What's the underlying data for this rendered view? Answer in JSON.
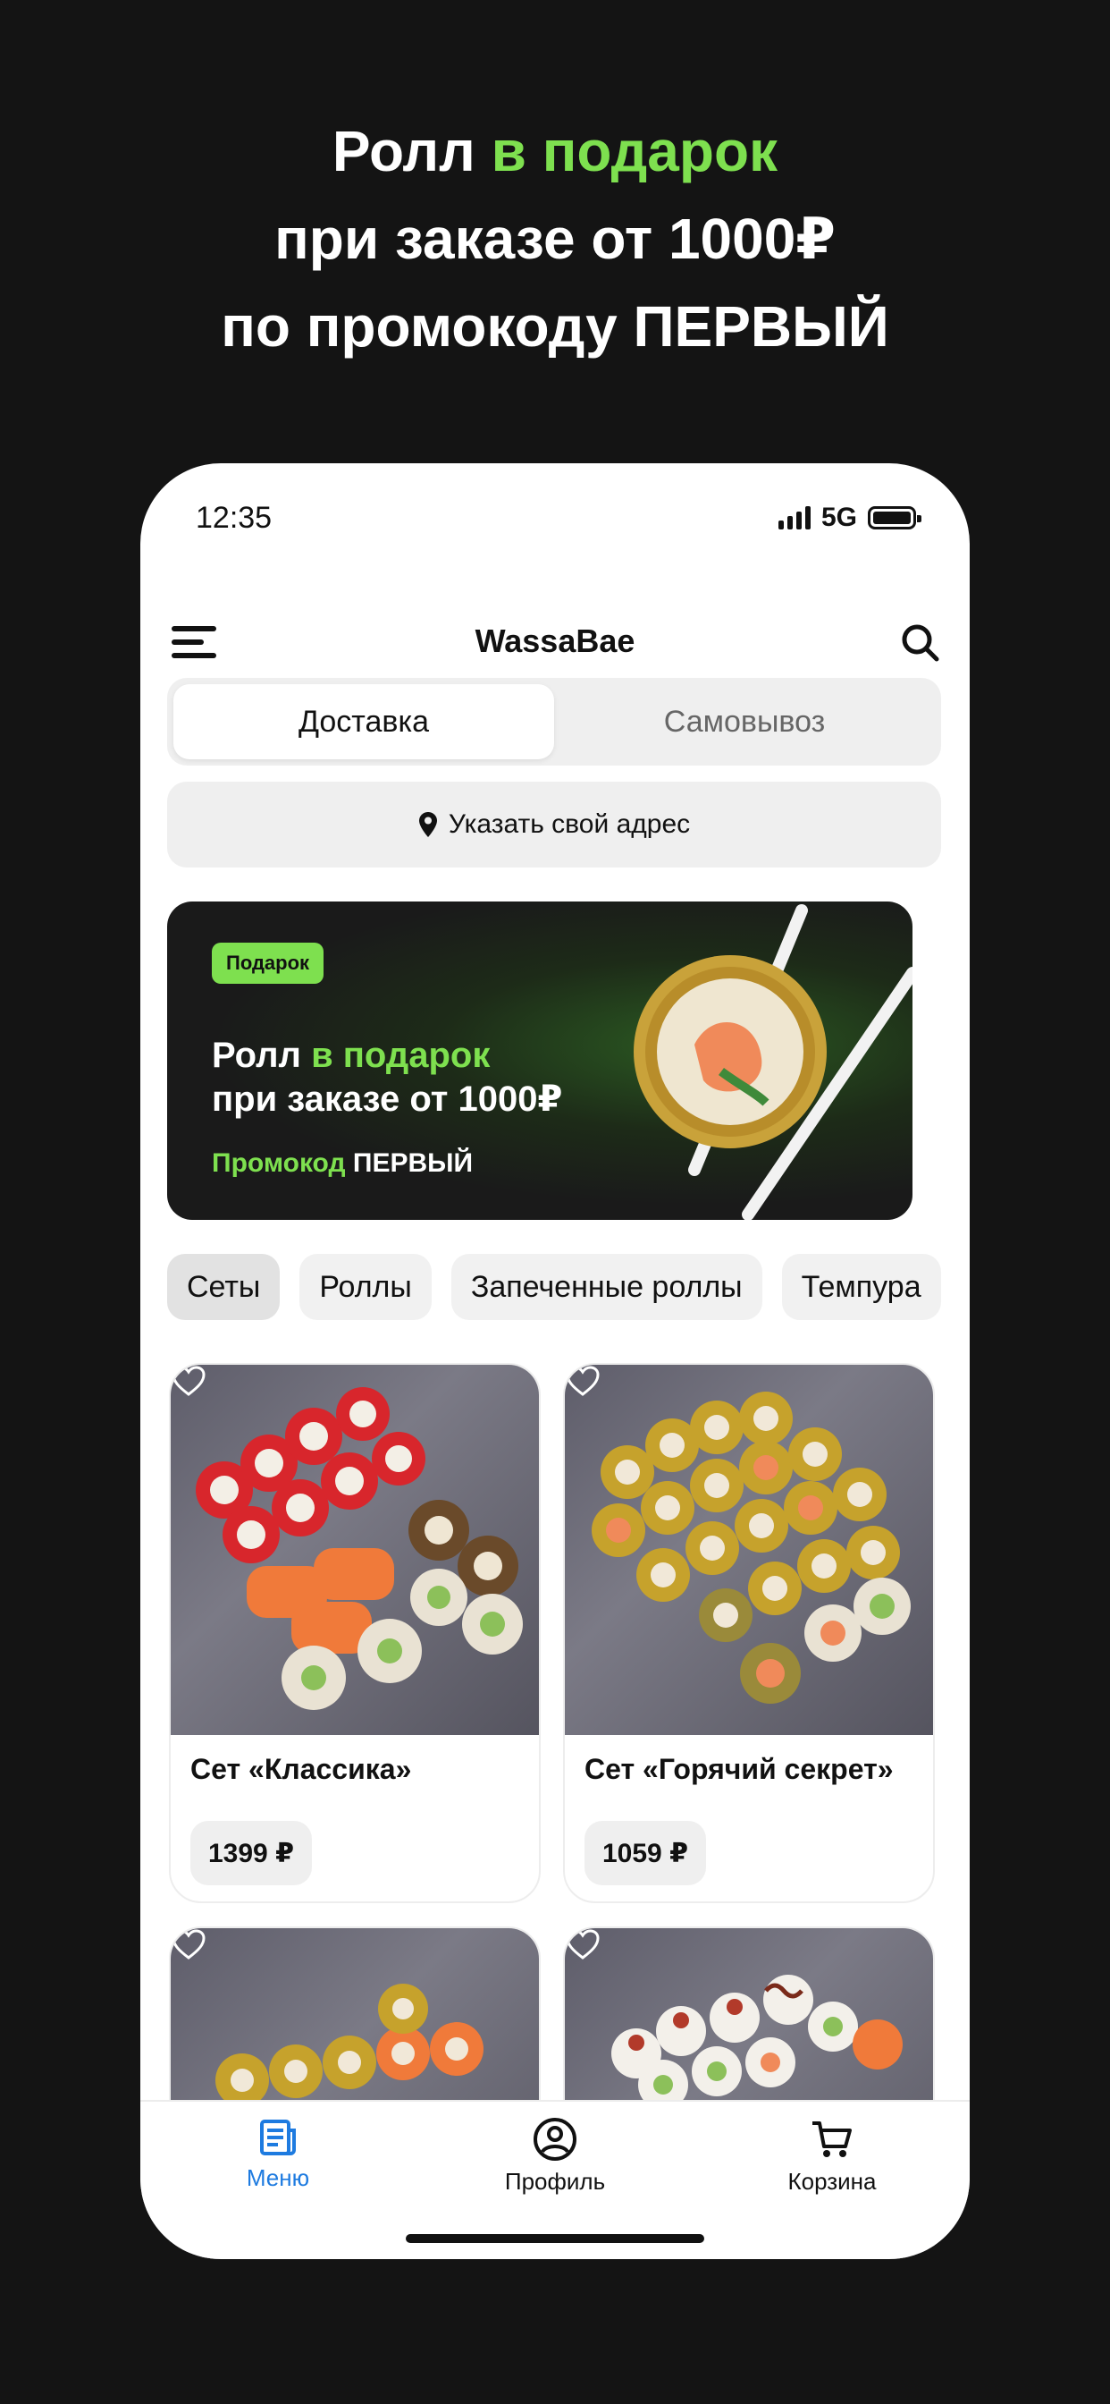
{
  "hero": {
    "line1_a": "Ролл ",
    "line1_b": "в подарок",
    "line2": "при заказе от 1000₽",
    "line3": "по промокоду ПЕРВЫЙ"
  },
  "status_bar": {
    "time": "12:35",
    "network": "5G"
  },
  "app": {
    "title": "WassaBae"
  },
  "delivery_toggle": {
    "options": [
      "Доставка",
      "Самовывоз"
    ],
    "selected": "Доставка"
  },
  "address": {
    "label": "Указать свой адрес"
  },
  "banner": {
    "badge": "Подарок",
    "line1_a": "Ролл ",
    "line1_b": "в подарок",
    "line2": "при заказе от 1000₽",
    "promo_label": "Промокод",
    "promo_code": "ПЕРВЫЙ"
  },
  "categories": [
    "Сеты",
    "Роллы",
    "Запеченные роллы",
    "Темпура"
  ],
  "products": [
    {
      "name": "Сет «Классика»",
      "price": "1399 ₽"
    },
    {
      "name": "Сет «Горячий секрет»",
      "price": "1059 ₽"
    }
  ],
  "tabbar": {
    "menu": "Меню",
    "profile": "Профиль",
    "cart": "Корзина"
  },
  "colors": {
    "accent_green": "#7ee04f",
    "active_tab_blue": "#1e7be0",
    "background": "#141414"
  },
  "icons": [
    "menu-icon",
    "search-icon",
    "location-pin-icon",
    "heart-icon",
    "menu-tab-icon",
    "profile-icon",
    "cart-icon"
  ]
}
